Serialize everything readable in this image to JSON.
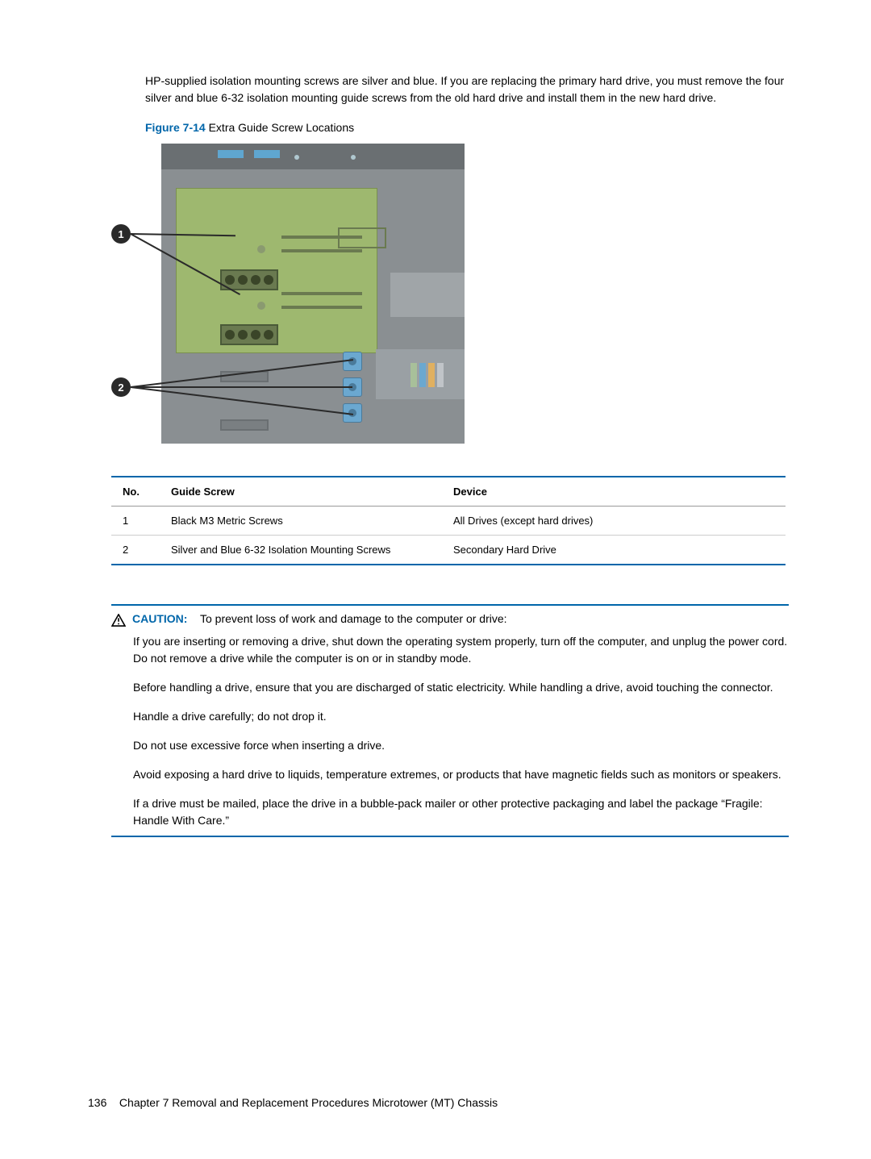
{
  "intro": "HP-supplied isolation mounting screws are silver and blue. If you are replacing the primary hard drive, you must remove the four silver and blue 6-32 isolation mounting guide screws from the old hard drive and install them in the new hard drive.",
  "figure": {
    "num": "Figure 7-14",
    "title": "Extra Guide Screw Locations"
  },
  "callouts": {
    "c1": "1",
    "c2": "2"
  },
  "table": {
    "headers": {
      "no": "No.",
      "screw": "Guide Screw",
      "device": "Device"
    },
    "rows": [
      {
        "no": "1",
        "screw": "Black M3 Metric Screws",
        "device": "All Drives (except hard drives)"
      },
      {
        "no": "2",
        "screw": "Silver and Blue 6-32 Isolation Mounting Screws",
        "device": "Secondary Hard Drive"
      }
    ]
  },
  "caution": {
    "label": "CAUTION:",
    "intro": "To prevent loss of work and damage to the computer or drive:",
    "p1": "If you are inserting or removing a drive, shut down the operating system properly, turn off the computer, and unplug the power cord. Do not remove a drive while the computer is on or in standby mode.",
    "p2": "Before handling a drive, ensure that you are discharged of static electricity. While handling a drive, avoid touching the connector.",
    "p3": "Handle a drive carefully; do not drop it.",
    "p4": "Do not use excessive force when inserting a drive.",
    "p5": "Avoid exposing a hard drive to liquids, temperature extremes, or products that have magnetic fields such as monitors or speakers.",
    "p6": "If a drive must be mailed, place the drive in a bubble-pack mailer or other protective packaging and label the package “Fragile: Handle With Care.”"
  },
  "footer": {
    "page": "136",
    "chapter": "Chapter 7   Removal and Replacement Procedures Microtower (MT) Chassis"
  }
}
